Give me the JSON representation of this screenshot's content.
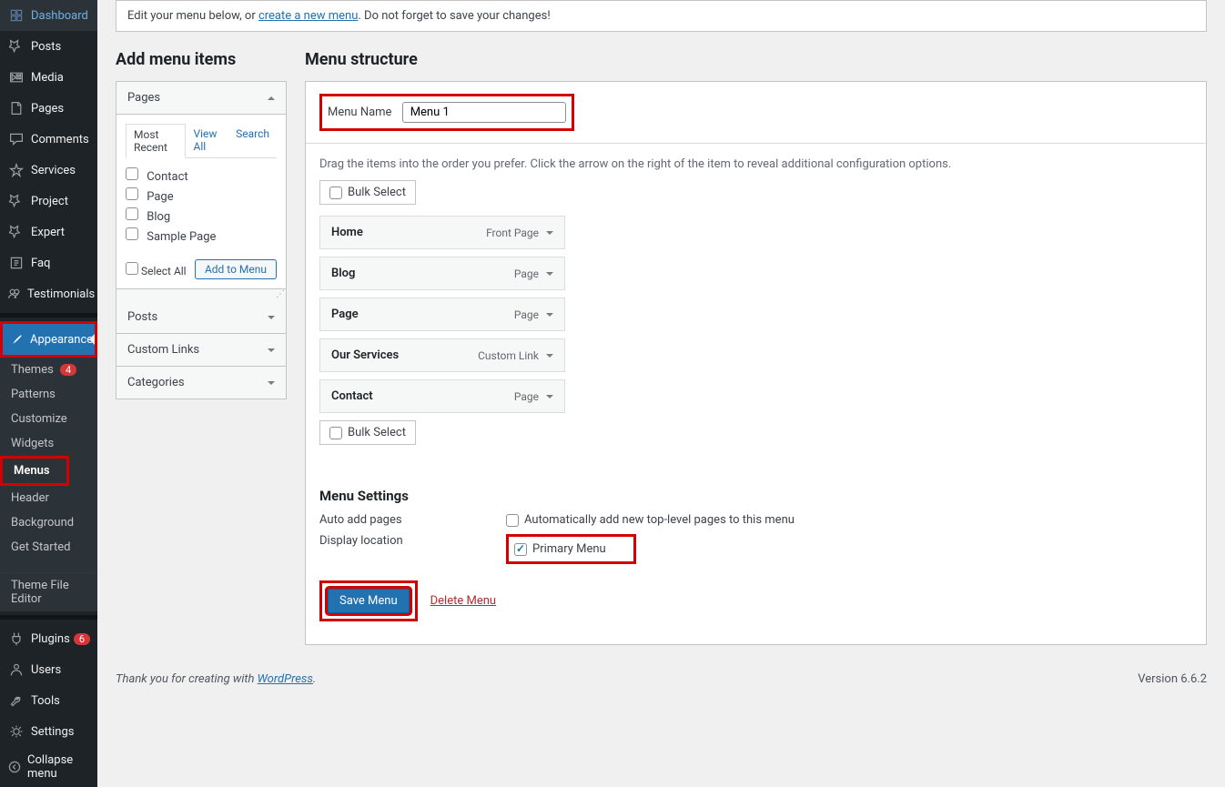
{
  "sidebar": {
    "items": [
      {
        "label": "Dashboard",
        "icon": "dashboard"
      },
      {
        "label": "Posts",
        "icon": "pin"
      },
      {
        "label": "Media",
        "icon": "media"
      },
      {
        "label": "Pages",
        "icon": "pages"
      },
      {
        "label": "Comments",
        "icon": "comments"
      },
      {
        "label": "Services",
        "icon": "star"
      },
      {
        "label": "Project",
        "icon": "pin"
      },
      {
        "label": "Expert",
        "icon": "pin"
      },
      {
        "label": "Faq",
        "icon": "faq"
      },
      {
        "label": "Testimonials",
        "icon": "users"
      }
    ],
    "active": {
      "label": "Appearance",
      "icon": "brush"
    },
    "sub": [
      {
        "label": "Themes",
        "badge": "4"
      },
      {
        "label": "Patterns"
      },
      {
        "label": "Customize"
      },
      {
        "label": "Widgets"
      },
      {
        "label": "Menus",
        "current": true
      },
      {
        "label": "Header"
      },
      {
        "label": "Background"
      },
      {
        "label": "Get Started"
      },
      {
        "label": "Theme File Editor",
        "spaced": true
      }
    ],
    "items2": [
      {
        "label": "Plugins",
        "icon": "plugin",
        "badge": "6"
      },
      {
        "label": "Users",
        "icon": "user"
      },
      {
        "label": "Tools",
        "icon": "tools"
      },
      {
        "label": "Settings",
        "icon": "settings"
      },
      {
        "label": "Collapse menu",
        "icon": "collapse"
      }
    ]
  },
  "notice": {
    "pre": "Edit your menu below, or ",
    "link": "create a new menu",
    "post": ". Do not forget to save your changes!"
  },
  "left": {
    "title": "Add menu items",
    "pages": "Pages",
    "tabs": [
      "Most Recent",
      "View All",
      "Search"
    ],
    "checks": [
      "Contact",
      "Page",
      "Blog",
      "Sample Page"
    ],
    "select_all": "Select All",
    "add": "Add to Menu",
    "sections": [
      "Posts",
      "Custom Links",
      "Categories"
    ]
  },
  "right": {
    "title": "Menu structure",
    "name_label": "Menu Name",
    "name_value": "Menu 1",
    "help": "Drag the items into the order you prefer. Click the arrow on the right of the item to reveal additional configuration options.",
    "bulk": "Bulk Select",
    "items": [
      {
        "label": "Home",
        "type": "Front Page"
      },
      {
        "label": "Blog",
        "type": "Page"
      },
      {
        "label": "Page",
        "type": "Page"
      },
      {
        "label": "Our Services",
        "type": "Custom Link"
      },
      {
        "label": "Contact",
        "type": "Page"
      }
    ],
    "settings_title": "Menu Settings",
    "auto_label": "Auto add pages",
    "auto_check": "Automatically add new top-level pages to this menu",
    "loc_label": "Display location",
    "loc_check": "Primary Menu",
    "save": "Save Menu",
    "delete": "Delete Menu"
  },
  "footer": {
    "thanks": "Thank you for creating with ",
    "wp": "WordPress",
    "period": ".",
    "ver": "Version 6.6.2"
  }
}
